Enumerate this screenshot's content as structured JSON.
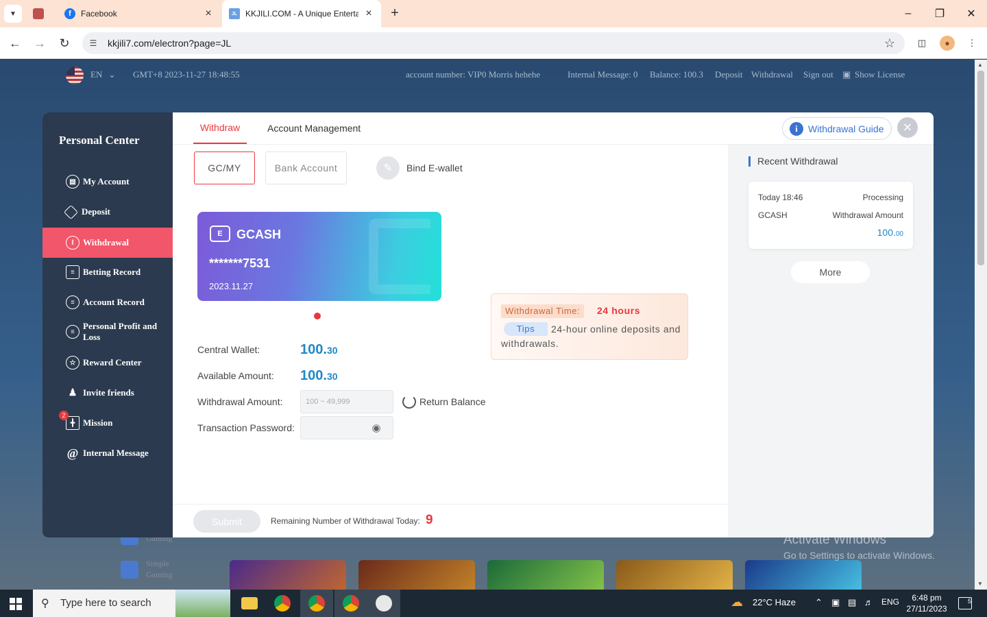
{
  "browser": {
    "tabs": [
      {
        "title": "Facebook"
      },
      {
        "title": "KKJILI.COM - A Unique Entertainment"
      }
    ],
    "url": "kkjili7.com/electron?page=JL",
    "new_tab": "+"
  },
  "site_header": {
    "lang": "EN",
    "time": "GMT+8 2023-11-27 18:48:55",
    "account": "account number: VIP0 Morris hehehe",
    "internal_message": "Internal Message: 0",
    "balance": "Balance: 100.3",
    "deposit": "Deposit",
    "withdrawal": "Withdrawal",
    "sign_out": "Sign out",
    "show_license": "Show License"
  },
  "site_sidebar": [
    {
      "label": "Gaming"
    },
    {
      "label": "Simple Gaming"
    }
  ],
  "watermark": {
    "line1": "Activate Windows",
    "line2": "Go to Settings to activate Windows."
  },
  "modal": {
    "sidebar_title": "Personal Center",
    "menu": [
      {
        "label": "My Account",
        "icon": "id-card-icon"
      },
      {
        "label": "Deposit",
        "icon": "diamond-icon"
      },
      {
        "label": "Withdrawal",
        "icon": "bars-icon",
        "active": true
      },
      {
        "label": "Betting Record",
        "icon": "receipt-icon"
      },
      {
        "label": "Account Record",
        "icon": "list-icon"
      },
      {
        "label": "Personal Profit and Loss",
        "icon": "chart-icon"
      },
      {
        "label": "Reward Center",
        "icon": "star-icon"
      },
      {
        "label": "Invite friends",
        "icon": "users-icon"
      },
      {
        "label": "Mission",
        "icon": "gift-icon",
        "badge": "2"
      },
      {
        "label": "Internal Message",
        "icon": "at-icon"
      }
    ],
    "tabs": [
      "Withdraw",
      "Account Management"
    ],
    "guide_label": "Withdrawal Guide",
    "methods": [
      "GC/MY",
      "Bank Account"
    ],
    "bind_label": "Bind E-wallet",
    "card": {
      "logo": "E",
      "name": "GCASH",
      "number": "*******7531",
      "date": "2023.11.27"
    },
    "form": {
      "central_wallet_label": "Central Wallet:",
      "central_wallet_int": "100.",
      "central_wallet_dec": "30",
      "available_label": "Available Amount:",
      "available_int": "100.",
      "available_dec": "30",
      "withdrawal_label": "Withdrawal Amount:",
      "withdrawal_placeholder": "100 ~ 49,999",
      "return_balance": "Return Balance",
      "password_label": "Transaction Password:"
    },
    "tips": {
      "time_label": "Withdrawal Time:",
      "time_value": "24 hours",
      "tag": "Tips",
      "text": "24-hour online deposits and withdrawals."
    },
    "footer": {
      "submit": "Submit",
      "remaining_label": "Remaining Number of Withdrawal Today:",
      "remaining_value": "9"
    },
    "recent": {
      "title": "Recent Withdrawal",
      "time": "Today 18:46",
      "status": "Processing",
      "method": "GCASH",
      "amount_label": "Withdrawal Amount",
      "amount_int": "100.",
      "amount_dec": "00",
      "more": "More"
    }
  },
  "taskbar": {
    "search_placeholder": "Type here to search",
    "weather": "22°C  Haze",
    "lang": "ENG",
    "time": "6:48 pm",
    "date": "27/11/2023",
    "notifications": "5"
  },
  "colors": {
    "accent_red": "#e8383d",
    "active_menu": "#f2566a",
    "value_blue": "#1e88c8",
    "sidebar_bg": "#2b3a4e"
  }
}
